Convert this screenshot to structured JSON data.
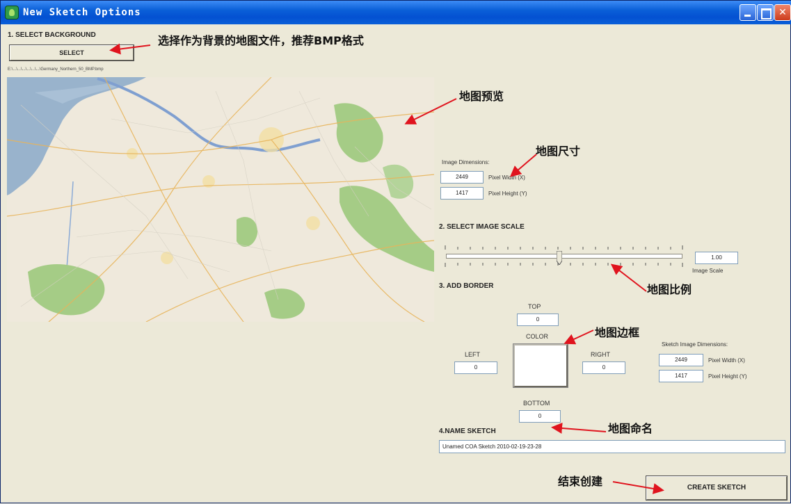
{
  "window": {
    "title": "New Sketch Options",
    "controls": {
      "minimize": "minimize-icon",
      "maximize": "maximize-icon",
      "close": "close-icon"
    }
  },
  "section1": {
    "heading": "1. SELECT BACKGROUND",
    "select_button": "SELECT",
    "file_path": "E:\\...\\...\\...\\...\\...\\...\\Germany_Northern_50_BMP.bmp",
    "annotation": "选择作为背景的地图文件，推荐BMP格式"
  },
  "map_preview": {
    "annotation": "地图预览"
  },
  "dimensions": {
    "heading": "Image Dimensions:",
    "width_value": "2449",
    "width_label": "Pixel Width (X)",
    "height_value": "1417",
    "height_label": "Pixel Height (Y)",
    "annotation": "地图尺寸"
  },
  "section2": {
    "heading": "2. SELECT IMAGE SCALE",
    "scale_value": "1.00",
    "scale_label": "Image Scale",
    "slider_position": 0.48,
    "annotation": "地图比例"
  },
  "section3": {
    "heading": "3. ADD BORDER",
    "top_label": "TOP",
    "top_value": "0",
    "left_label": "LEFT",
    "left_value": "0",
    "right_label": "RIGHT",
    "right_value": "0",
    "bottom_label": "BOTTOM",
    "bottom_value": "0",
    "color_label": "COLOR",
    "annotation": "地图边框"
  },
  "sketch_dimensions": {
    "heading": "Sketch Image Dimensions:",
    "width_value": "2449",
    "width_label": "Pixel Width (X)",
    "height_value": "1417",
    "height_label": "Pixel Height (Y)"
  },
  "section4": {
    "heading": "4.NAME SKETCH",
    "name_value": "Unamed COA Sketch 2010-02-19-23-28",
    "annotation": "地图命名"
  },
  "create": {
    "button": "CREATE SKETCH",
    "annotation": "结束创建"
  },
  "colors": {
    "titlebar": "#0a5fd8",
    "dialog_bg": "#ece9d8",
    "arrow": "#e0141e",
    "map_water": "#99b3cc",
    "map_forest": "#a5cc86"
  }
}
